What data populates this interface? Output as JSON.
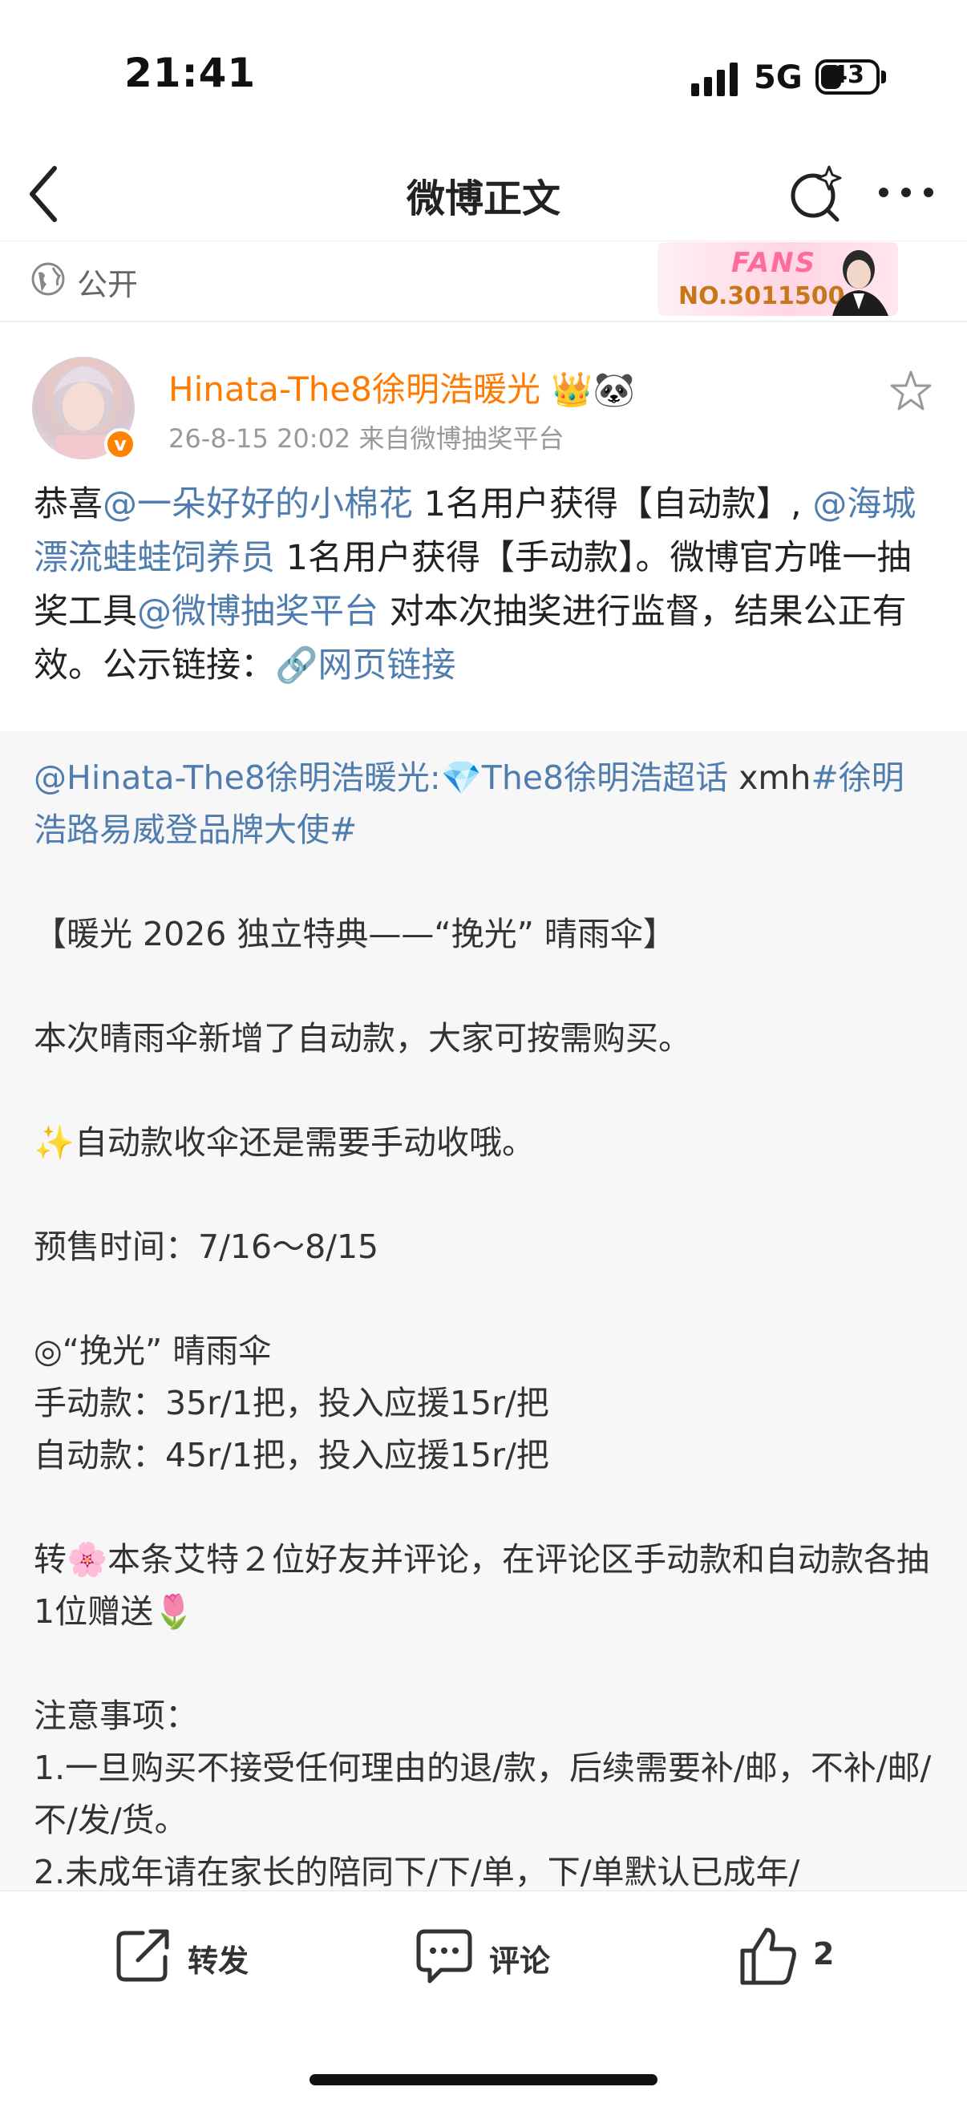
{
  "status_bar": {
    "time": "21:41",
    "network": "5G",
    "battery": "43"
  },
  "nav": {
    "title": "微博正文"
  },
  "visibility": {
    "label": "公开",
    "fans_badge": {
      "word": "FANS",
      "number": "NO.3011500"
    }
  },
  "post": {
    "author": "Hinata-The8徐明浩暖光",
    "author_emoji": "👑🐼",
    "meta": "26-8-15 20:02  来自微博抽奖平台",
    "text": {
      "p1": "恭喜",
      "m1": "@一朵好好的小棉花",
      "p2": " 1名用户获得【自动款】, ",
      "m2": "@海城漂流蛙蛙饲养员",
      "p3": " 1名用户获得【手动款】。微博官方唯一抽奖工具",
      "m3": "@微博抽奖平台",
      "p4": " 对本次抽奖进行监督，结果公正有效。公示链接：",
      "link": "🔗网页链接"
    }
  },
  "repost": {
    "mention": "@Hinata-The8徐明浩暖光:",
    "supertopic": "💎The8徐明浩超话",
    "tail": " xmh",
    "hashtag": "#徐明浩路易威登品牌大使#",
    "title": "【暖光 2026 独立特典——“挽光” 晴雨伞】",
    "line1": "本次晴雨伞新增了自动款，大家可按需购买。",
    "line2": "✨自动款收伞还是需要手动收哦。",
    "line3": "预售时间：7/16～8/15",
    "line4": "◎“挽光” 晴雨伞",
    "line5": "手动款：35r/1把，投入应援15r/把",
    "line6": "自动款：45r/1把，投入应援15r/把",
    "line7": "转🌸本条艾特２位好友并评论，在评论区手动款和自动款各抽1位赠送🌷",
    "line8": "注意事项：",
    "line9": "1.一旦购买不接受任何理由的退/款，后续需要补/邮，不补/邮/不/发/货。",
    "line10": "2.未成年请在家长的陪同下/下/单，下/单默认已成年/"
  },
  "actions": {
    "repost": "转发",
    "comment": "评论",
    "like": "2"
  }
}
